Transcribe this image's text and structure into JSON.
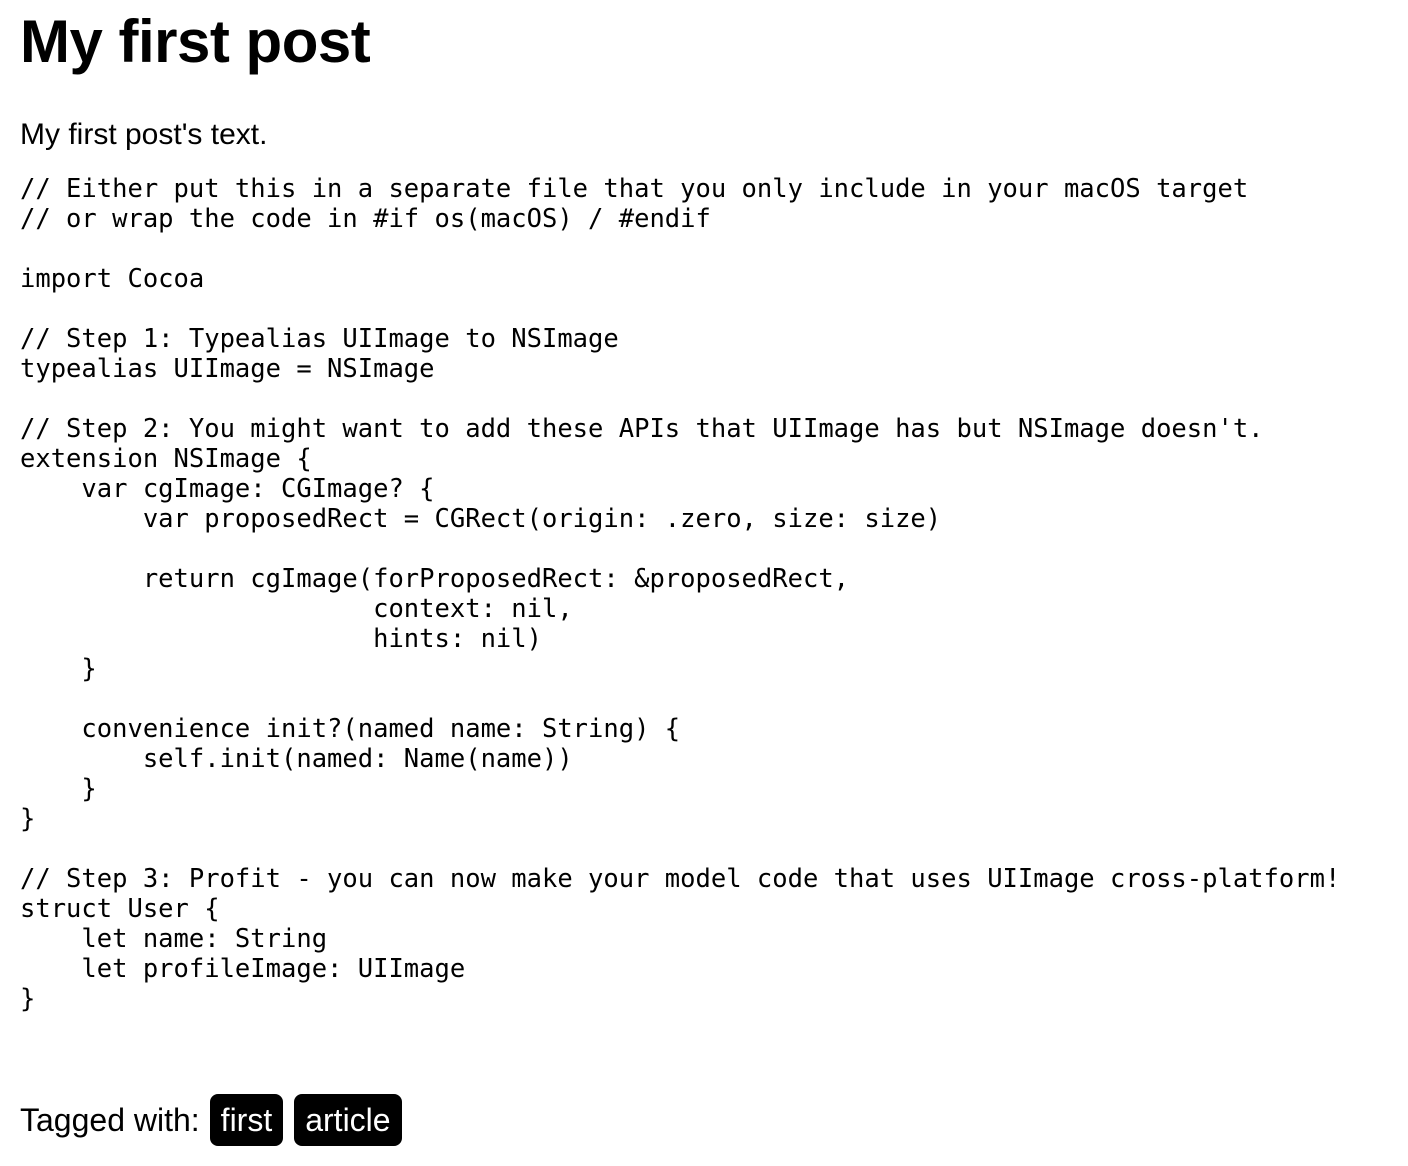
{
  "post": {
    "title": "My first post",
    "text": "My first post's text."
  },
  "code": {
    "lines": [
      "// Either put this in a separate file that you only include in your macOS target",
      "// or wrap the code in #if os(macOS) / #endif",
      "",
      "import Cocoa",
      "",
      "// Step 1: Typealias UIImage to NSImage",
      "typealias UIImage = NSImage",
      "",
      "// Step 2: You might want to add these APIs that UIImage has but NSImage doesn't.",
      "extension NSImage {",
      "    var cgImage: CGImage? {",
      "        var proposedRect = CGRect(origin: .zero, size: size)",
      "",
      "        return cgImage(forProposedRect: &proposedRect,",
      "                       context: nil,",
      "                       hints: nil)",
      "    }",
      "",
      "    convenience init?(named name: String) {",
      "        self.init(named: Name(name))",
      "    }",
      "}",
      "",
      "// Step 3: Profit - you can now make your model code that uses UIImage cross-platform!",
      "struct User {",
      "    let name: String",
      "    let profileImage: UIImage",
      "}"
    ]
  },
  "tags": {
    "label": "Tagged with:",
    "items": [
      "first",
      "article"
    ]
  }
}
